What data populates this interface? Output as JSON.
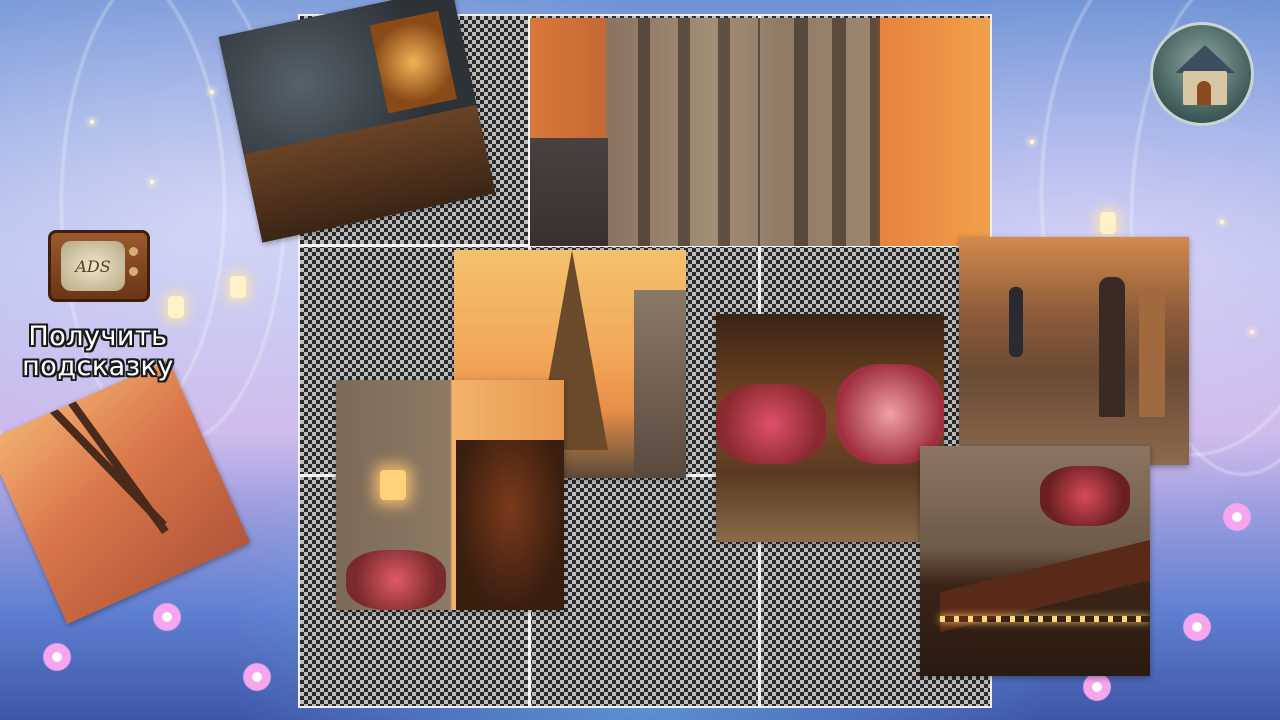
{
  "hint": {
    "label": "Получить подсказку",
    "tv_logo": "ADS",
    "icon": "retro-tv-icon"
  },
  "home": {
    "icon": "house-icon"
  },
  "board": {
    "rows": 3,
    "cols": 3
  },
  "pieces": [
    {
      "name": "vintage-car-street",
      "depicts": "vintage car on cobblestone street"
    },
    {
      "name": "building-facade-sunset",
      "depicts": "parisian building facade at sunset"
    },
    {
      "name": "eiffel-tower-sunset",
      "depicts": "eiffel tower at sunset"
    },
    {
      "name": "cafe-flowers",
      "depicts": "cafe terrace with flowers"
    },
    {
      "name": "couple-walking-street",
      "depicts": "couple walking on cobblestone street"
    },
    {
      "name": "street-lamp-building",
      "depicts": "street lamp and building at dusk"
    },
    {
      "name": "building-cafe-lights",
      "depicts": "building with lit cafe awning"
    },
    {
      "name": "eiffel-tower-tilted",
      "depicts": "eiffel tower against orange sky"
    }
  ]
}
